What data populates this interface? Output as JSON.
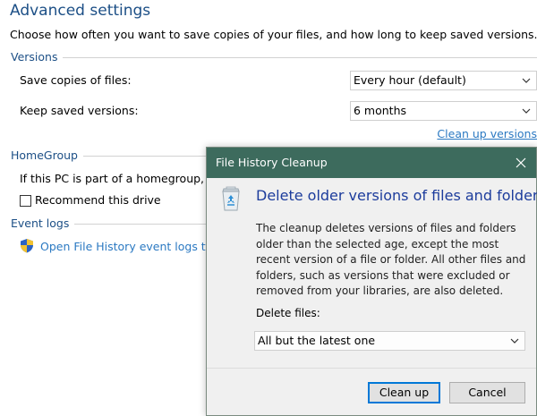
{
  "settings": {
    "title": "Advanced settings",
    "description": "Choose how often you want to save copies of your files, and how long to keep saved versions.",
    "versions": {
      "group_label": "Versions",
      "save_copies_label": "Save copies of files:",
      "save_copies_value": "Every hour (default)",
      "keep_versions_label": "Keep saved versions:",
      "keep_versions_value": "6 months",
      "cleanup_link": "Clean up versions"
    },
    "homegroup": {
      "group_label": "HomeGroup",
      "text": "If this PC is part of a homegroup, you",
      "recommend_label": "Recommend this drive",
      "recommend_checked": false
    },
    "event_logs": {
      "group_label": "Event logs",
      "link_text": "Open File History event logs to vie"
    }
  },
  "dialog": {
    "title": "File History Cleanup",
    "heading": "Delete older versions of files and folders",
    "body": "The cleanup deletes versions of files and folders older than the selected age, except the most recent version of a file or folder. All other files and folders, such as versions that were excluded or removed from your libraries, are also deleted.",
    "delete_files_label": "Delete files:",
    "delete_files_value": "All but the latest one",
    "cleanup_button": "Clean up",
    "cancel_button": "Cancel"
  },
  "colors": {
    "heading_blue": "#1c4f86",
    "link_blue": "#2b79c2",
    "titlebar_green": "#3d6b5d",
    "dialog_heading_blue": "#1c3c9c",
    "focus_blue": "#0078d7"
  }
}
